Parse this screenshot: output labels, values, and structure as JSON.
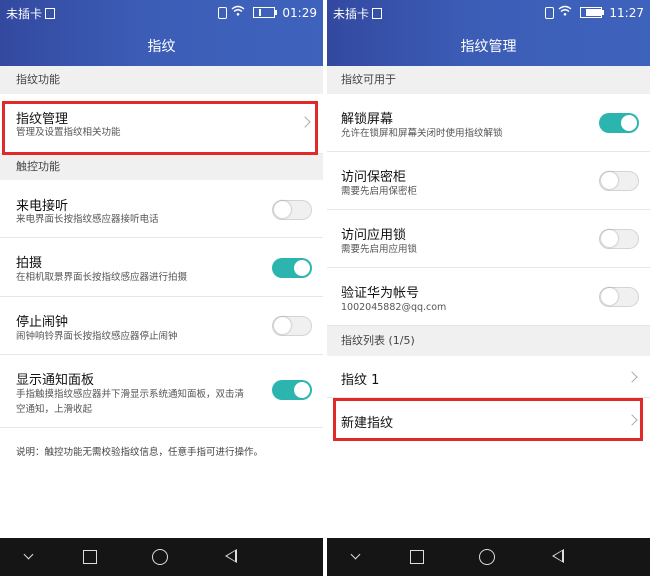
{
  "left": {
    "status": {
      "carrier": "未插卡",
      "time": "01:29",
      "battery_level": 0.15
    },
    "title": "指纹",
    "section_fingerprint": "指纹功能",
    "manage": {
      "title": "指纹管理",
      "subtitle": "管理及设置指纹相关功能"
    },
    "section_touch": "触控功能",
    "items": [
      {
        "title": "来电接听",
        "subtitle": "来电界面长按指纹感应器接听电话",
        "on": false
      },
      {
        "title": "拍摄",
        "subtitle": "在相机取景界面长按指纹感应器进行拍摄",
        "on": true
      },
      {
        "title": "停止闹钟",
        "subtitle": "闹钟响铃界面长按指纹感应器停止闹钟",
        "on": false
      },
      {
        "title": "显示通知面板",
        "subtitle_line1": "手指触摸指纹感应器并下滑显示系统通知面板，双击清",
        "subtitle_line2": "空通知，上滑收起",
        "on": true
      }
    ],
    "note": "说明：触控功能无需校验指纹信息，任意手指可进行操作。"
  },
  "right": {
    "status": {
      "carrier": "未插卡",
      "time": "11:27",
      "battery_level": 0.9
    },
    "title": "指纹管理",
    "section_use": "指纹可用于",
    "items": [
      {
        "title": "解锁屏幕",
        "subtitle": "允许在锁屏和屏幕关闭时使用指纹解锁",
        "on": true
      },
      {
        "title": "访问保密柜",
        "subtitle": "需要先启用保密柜",
        "on": false
      },
      {
        "title": "访问应用锁",
        "subtitle": "需要先启用应用锁",
        "on": false
      },
      {
        "title": "验证华为帐号",
        "subtitle": "1002045882@qq.com",
        "on": false
      }
    ],
    "section_list": "指纹列表 (1/5)",
    "fingerprint1": "指纹 1",
    "new_fingerprint": "新建指纹"
  },
  "colors": {
    "header": "#3c5db6",
    "toggle_on": "#2bb5ae",
    "highlight": "#e02a2a",
    "navbar": "#151515"
  },
  "icons": [
    "vibrate-icon",
    "wifi-icon",
    "battery-icon",
    "chevron-right-icon",
    "back-nav-icon",
    "home-nav-icon",
    "recents-nav-icon",
    "down-nav-icon"
  ]
}
